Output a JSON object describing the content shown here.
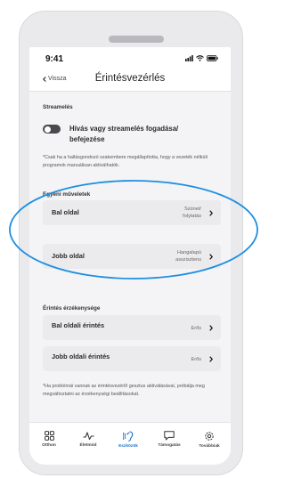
{
  "status_bar": {
    "time": "9:41"
  },
  "nav": {
    "back_label": "Vissza",
    "title": "Érintésvezérlés"
  },
  "streaming": {
    "heading": "Streamelés",
    "toggle_label": "Hívás vagy streamelés fogadása/ befejezése",
    "toggle_on": false,
    "note": "*Csak ha a hallásgondozó szakembere megállapította, hogy a vezeték nélküli programok manuálisan aktiválhatók."
  },
  "custom_ops": {
    "heading": "Egyéni műveletek",
    "items": [
      {
        "label": "Bal oldal",
        "value": "Szünet/ folytatás"
      },
      {
        "label": "Jobb oldal",
        "value": "Hangalapú asszisztens"
      }
    ]
  },
  "sensitivity": {
    "heading": "Érintés érzékenysége",
    "items": [
      {
        "label": "Bal oldali érintés",
        "value": "Erős"
      },
      {
        "label": "Jobb oldali érintés",
        "value": "Erős"
      }
    ],
    "note": "*Ha problémái vannak az érintésvezérlő gesztus aktiválásával, próbálja meg megváltoztatni az érzékenységi beállításokat."
  },
  "tabbar": {
    "tabs": [
      {
        "label": "Otthon",
        "icon": "grid-icon"
      },
      {
        "label": "Életmód",
        "icon": "activity-icon"
      },
      {
        "label": "Eszközök",
        "icon": "hearing-aid-icon"
      },
      {
        "label": "Támogatás",
        "icon": "chat-icon"
      },
      {
        "label": "Továbbiak",
        "icon": "gear-icon"
      }
    ],
    "active": "Eszközök"
  },
  "colors": {
    "accent": "#1f73c9",
    "annotation": "#1e8fe0"
  }
}
